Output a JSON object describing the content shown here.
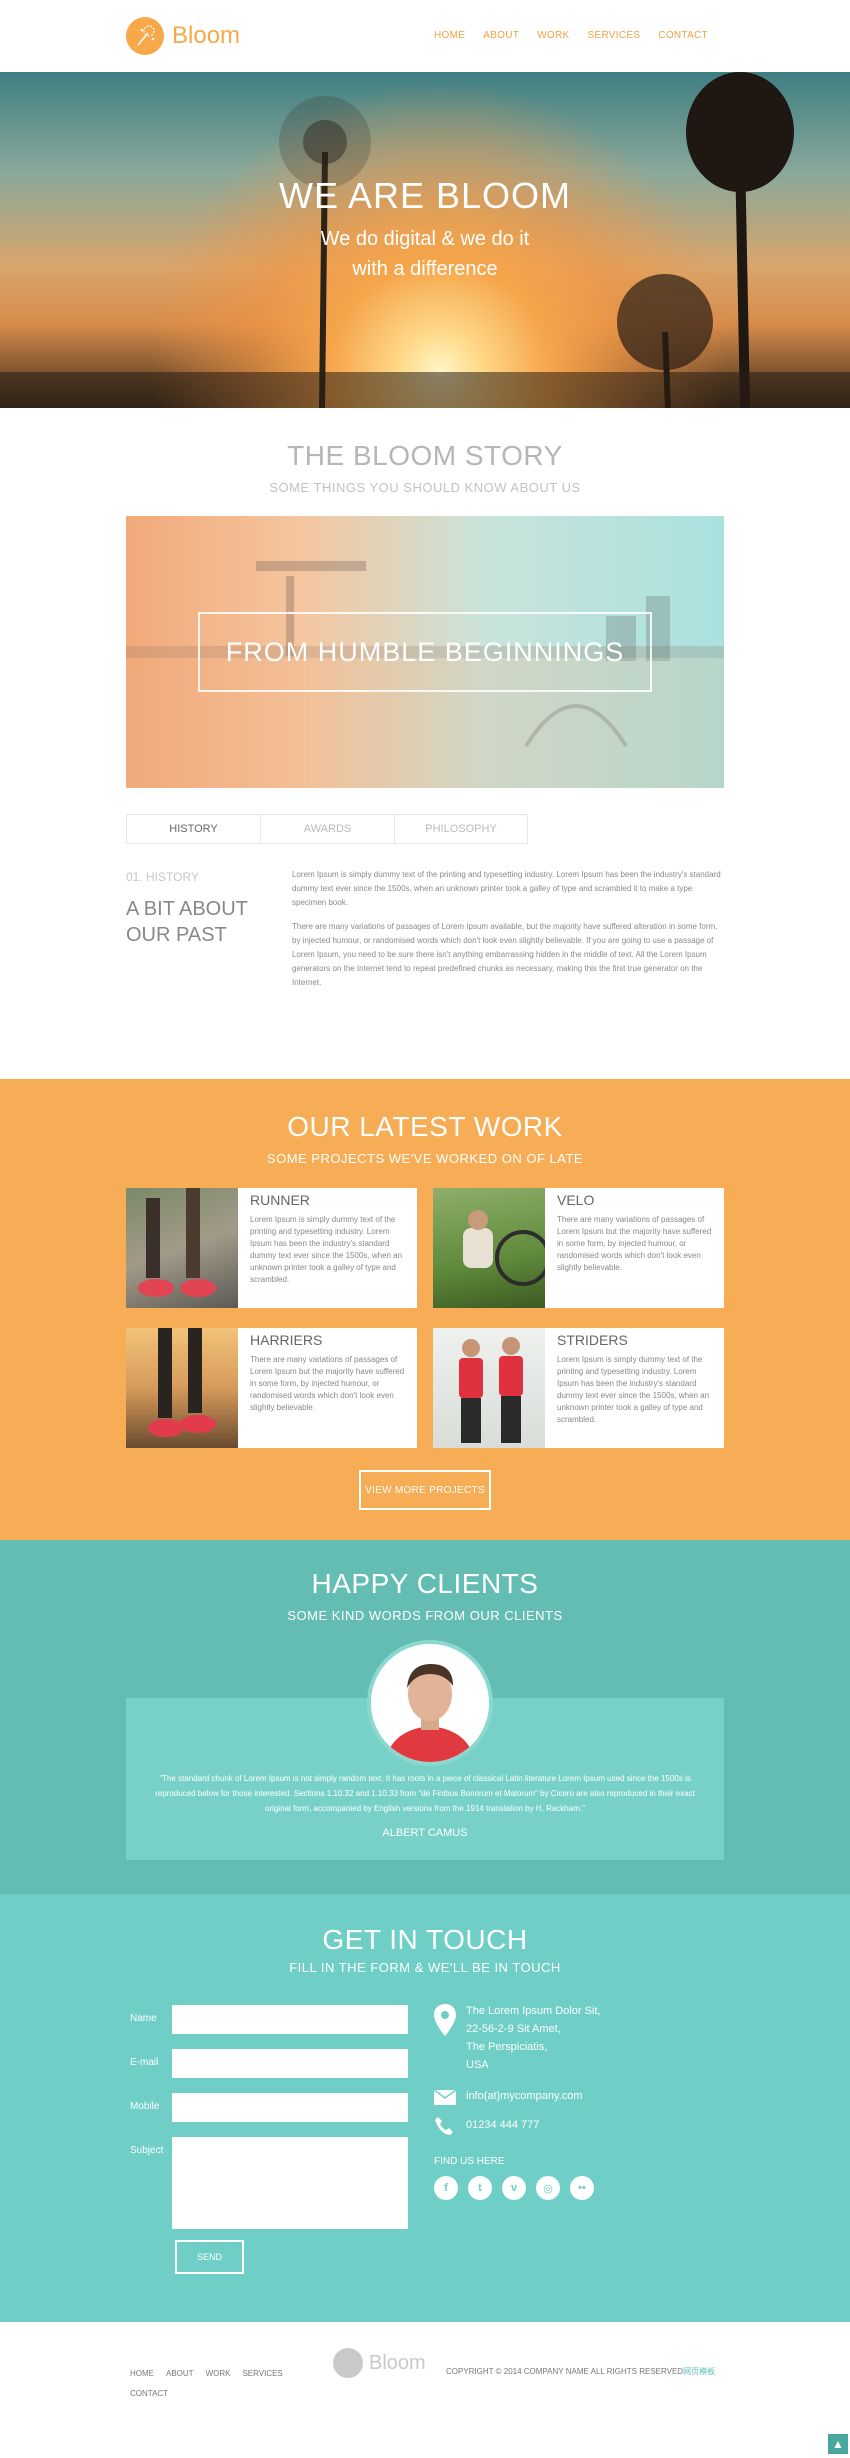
{
  "header": {
    "logo_text": "Bloom",
    "nav": [
      "HOME",
      "ABOUT",
      "WORK",
      "SERVICES",
      "CONTACT"
    ]
  },
  "hero": {
    "title": "WE ARE BLOOM",
    "subtitle": "We do digital & we do it with a difference"
  },
  "story": {
    "title": "THE BLOOM STORY",
    "subtitle": "SOME THINGS YOU SHOULD KNOW ABOUT US",
    "banner_text": "FROM HUMBLE BEGINNINGS",
    "tabs": [
      "HISTORY",
      "AWARDS",
      "PHILOSOPHY"
    ],
    "section_label": "01. HISTORY",
    "heading": "A BIT ABOUT OUR PAST",
    "paragraph1": "Lorem Ipsum is simply dummy text of the printing and typesetting industry. Lorem Ipsum has been the industry's standard dummy text ever since the 1500s, when an unknown printer took a galley of type and scrambled it to make a type specimen book.",
    "paragraph2": "There are many variations of passages of Lorem Ipsum available, but the majority have suffered alteration in some form, by injected humour, or randomised words which don't look even slightly believable. If you are going to use a passage of Lorem Ipsum, you need to be sure there isn't anything embarrassing hidden in the middle of text. All the Lorem Ipsum generators on the Internet tend to repeat predefined chunks as necessary, making this the first true generator on the Internet."
  },
  "work": {
    "title": "OUR LATEST WORK",
    "subtitle": "SOME PROJECTS WE'VE WORKED ON OF LATE",
    "projects": [
      {
        "title": "RUNNER",
        "text": "Lorem Ipsum is simply dummy text of the printing and typesetting industry. Lorem Ipsum has been the industry's standard dummy text ever since the 1500s, when an unknown printer took a galley of type and scrambled."
      },
      {
        "title": "VELO",
        "text": "There are many variations of passages of Lorem Ipsum but the majority have suffered in some form, by injected humour, or randomised words which don't look even slightly believable."
      },
      {
        "title": "HARRIERS",
        "text": "There are many variations of passages of Lorem Ipsum but the majority have suffered in some form, by injected humour, or randomised words which don't look even slightly believable."
      },
      {
        "title": "STRIDERS",
        "text": "Lorem Ipsum is simply dummy text of the printing and typesetting industry. Lorem Ipsum has been the industry's standard dummy text ever since the 1500s, when an unknown printer took a galley of type and scrambled."
      }
    ],
    "button": "VIEW MORE PROJECTS"
  },
  "clients": {
    "title": "HAPPY CLIENTS",
    "subtitle": "SOME KIND WORDS FROM OUR CLIENTS",
    "quote": "\"The standard chunk of Lorem Ipsum is not simply random text. It has roots in a piece of classical Latin literature Lorem Ipsum used since the 1500s is reproduced below for those interested. Sections 1.10.32 and 1.10.33 from \"de Finibus Bonorum et Malorum\" by Cicero are also reproduced in their exact original form, accompanied by English versions from the 1914 translation by H. Rackham.\"",
    "author": "ALBERT CAMUS"
  },
  "contact": {
    "title": "GET IN TOUCH",
    "subtitle": "FILL IN THE FORM & WE'LL BE IN TOUCH",
    "labels": {
      "name": "Name",
      "email": "E-mail",
      "mobile": "Mobile",
      "subject": "Subject"
    },
    "send": "SEND",
    "address": [
      "The Lorem Ipsum Dolor Sit,",
      "22-56-2-9 Sit Amet,",
      "The Perspiciatis,",
      "USA"
    ],
    "email": "info(at)mycompany.com",
    "phone": "01234 444 777",
    "find_us": "FIND US HERE",
    "social_glyphs": [
      "f",
      "t",
      "v",
      "◎",
      "••"
    ]
  },
  "footer": {
    "links": [
      "HOME",
      "ABOUT",
      "WORK",
      "SERVICES",
      "CONTACT"
    ],
    "logo_text": "Bloom",
    "copyright": "COPYRIGHT © 2014 COMPANY NAME ALL RIGHTS RESERVED",
    "copyright_accent": "网页模板",
    "to_top": "▲"
  },
  "colors": {
    "accent": "#f7a84a",
    "work_bg": "#f7ad55",
    "clients_bg": "#63bdb3",
    "contact_bg": "#6fcfc7"
  }
}
